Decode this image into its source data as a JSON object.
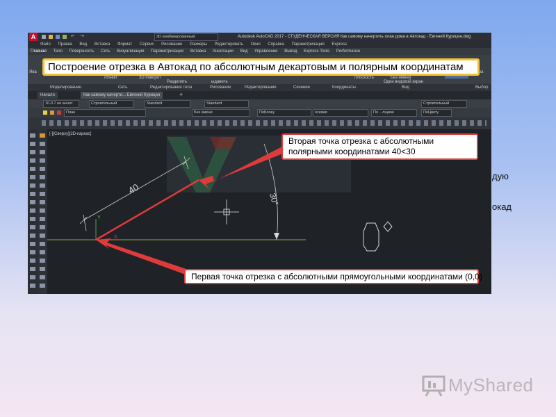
{
  "slide": {
    "background_text_1": "дую",
    "background_text_2": "окад",
    "logo_text": "MyShared"
  },
  "app": {
    "title": "Autodesk AutoCAD 2017 - СТУДЕНЧЕСКАЯ ВЕРСИЯ    Как самому начертить план дома в Автокад - Евгений Курицин.dwg",
    "workspace": "3D комбинированный",
    "menu": [
      "Файл",
      "Правка",
      "Вид",
      "Вставка",
      "Формат",
      "Сервис",
      "Рисование",
      "Размеры",
      "Редактировать",
      "Окно",
      "Справка",
      "Параметризация",
      "Express"
    ],
    "ribbon_tabs": [
      "Главная",
      "Тело",
      "Поверхность",
      "Сеть",
      "Визуализация",
      "Параметризация",
      "Вставка",
      "Аннотации",
      "Вид",
      "Управление",
      "Вывод",
      "Express Tools",
      "Performance"
    ],
    "ribbon_items": {
      "object": "объект",
      "rotate3d": "3D поворот",
      "plane": "плоскость",
      "no_name": "Без имени",
      "viewport": "Один видовой экран",
      "split": "Разделить",
      "extrude": "ыдавить",
      "right": "тра",
      "yavl": "Ява"
    },
    "panels": [
      "Моделирование",
      "Сеть",
      "Редактирование тела",
      "Рисование",
      "Редактирование",
      "Сечение",
      "Координаты",
      "Вид",
      "Выбор"
    ],
    "doc_tabs": [
      "Начало",
      "Как самому начерти... Евгений Курицин"
    ],
    "toolbar1": {
      "scale": "10-0.7 не аннот",
      "style1": "Строительный",
      "style2": "Standard",
      "style3": "Standard",
      "style4": "Строительный"
    },
    "toolbar2": {
      "layer": "План",
      "noname": "Без имени",
      "bylayer": "ПоБлоку",
      "linetype": "осевая",
      "lineweight": "По ...лщине",
      "plot": "ПоЦвету"
    },
    "view_label": "[-][Сверху][2D-каркас]"
  },
  "overlay": {
    "title": "Построение отрезка в Автокад по абсолютным декартовым и полярным координатам",
    "callout_second": "Вторая точка отрезка с абсолютными полярными координатами 40<30",
    "callout_first": "Первая точка отрезка с абсолютными прямоугольными координатами (0,0)"
  },
  "drawing": {
    "dimension_length": "40",
    "dimension_angle": "30°",
    "axis_y": "Y",
    "axis_x": "X"
  },
  "colors": {
    "accent_red": "#e03b3b",
    "highlight_yellow": "#f2c233",
    "canvas": "#1f2227"
  }
}
